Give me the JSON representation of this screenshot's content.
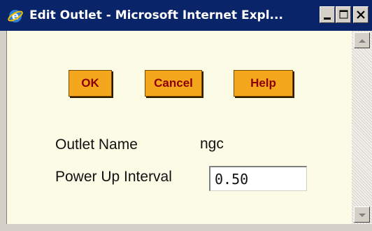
{
  "window": {
    "title": "Edit Outlet - Microsoft Internet Expl...",
    "icon": "internet-explorer-icon",
    "controls": [
      "minimize-icon",
      "maximize-icon",
      "close-icon"
    ]
  },
  "toolbar": {
    "ok_label": "OK",
    "cancel_label": "Cancel",
    "help_label": "Help"
  },
  "form": {
    "outlet_name_label": "Outlet Name",
    "outlet_name_value": "ngc",
    "power_up_label": "Power Up Interval",
    "power_up_value": "0.50"
  },
  "colors": {
    "titlebar": "#0a246a",
    "page_background": "#fbfbe6",
    "button_fill": "#f4a71c",
    "button_text": "#8b0000"
  }
}
